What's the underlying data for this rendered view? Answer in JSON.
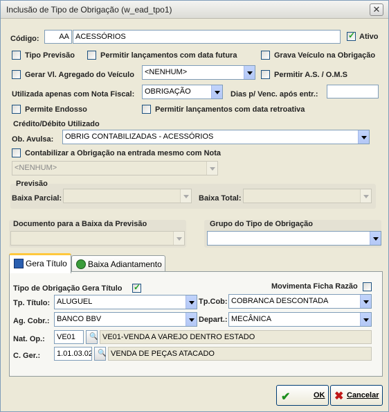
{
  "window": {
    "title": "Inclusão de Tipo de Obrigação (w_ead_tpo1)"
  },
  "form": {
    "codigo_label": "Código:",
    "codigo_value": "AA",
    "descricao_value": "ACESSÓRIOS",
    "ativo_label": "Ativo",
    "ativo_checked": true,
    "tipo_previsao_label": "Tipo Previsão",
    "permitir_lanc_futura_label": "Permitir lançamentos com data futura",
    "grava_veiculo_label": "Grava Veículo na Obrigação",
    "gerar_vl_agregado_label": "Gerar Vl. Agregado do Veículo",
    "gerar_vl_agregado_value": "<NENHUM>",
    "permitir_as_label": "Permitir A.S. / O.M.S",
    "utilizada_nota_label": "Utilizada apenas com Nota Fiscal:",
    "utilizada_nota_value": "OBRIGAÇÃO",
    "dias_venc_label": "Dias p/ Venc. após entr.:",
    "dias_venc_value": "",
    "permite_endosso_label": "Permite Endosso",
    "permitir_retroativa_label": "Permitir lançamentos com data retroativa"
  },
  "credito": {
    "section_title": "Crédito/Débito Utilizado",
    "ob_avulsa_label": "Ob. Avulsa:",
    "ob_avulsa_value": "OBRIG CONTABILIZADAS - ACESSÓRIOS",
    "contabilizar_label": "Contabilizar a Obrigação na entrada mesmo com Nota",
    "nenhum_value": "<NENHUM>"
  },
  "previsao": {
    "section_title": "Previsão",
    "baixa_parcial_label": "Baixa Parcial:",
    "baixa_total_label": "Baixa Total:"
  },
  "documento_baixa": {
    "label": "Documento para a Baixa da Previsão"
  },
  "grupo_tipo": {
    "label": "Grupo do Tipo de Obrigação"
  },
  "tabs": {
    "gera_titulo": "Gera Título",
    "baixa_adiantamento": "Baixa Adiantamento"
  },
  "titulo": {
    "tipo_gera_titulo_label": "Tipo de Obrigação Gera Título",
    "movimenta_ficha_label": "Movimenta Ficha Razão",
    "tp_titulo_label": "Tp. Título:",
    "tp_titulo_value": "ALUGUEL",
    "tp_cob_label": "Tp.Cob:",
    "tp_cob_value": "COBRANCA DESCONTADA",
    "ag_cobr_label": "Ag. Cobr.:",
    "ag_cobr_value": "BANCO BBV",
    "depart_label": "Depart.:",
    "depart_value": "MECÂNICA",
    "nat_op_label": "Nat. Op.:",
    "nat_op_code": "VE01",
    "nat_op_desc": "VE01-VENDA A VAREJO DENTRO ESTADO",
    "c_ger_label": "C. Ger.:",
    "c_ger_code": "1.01.03.02",
    "c_ger_desc": "VENDA DE PEÇAS ATACADO"
  },
  "buttons": {
    "ok": "OK",
    "cancelar": "Cancelar"
  },
  "colors": {
    "check_green": "#21a121",
    "tab_highlight": "#ffc83c",
    "border_blue": "#7f9db9"
  }
}
